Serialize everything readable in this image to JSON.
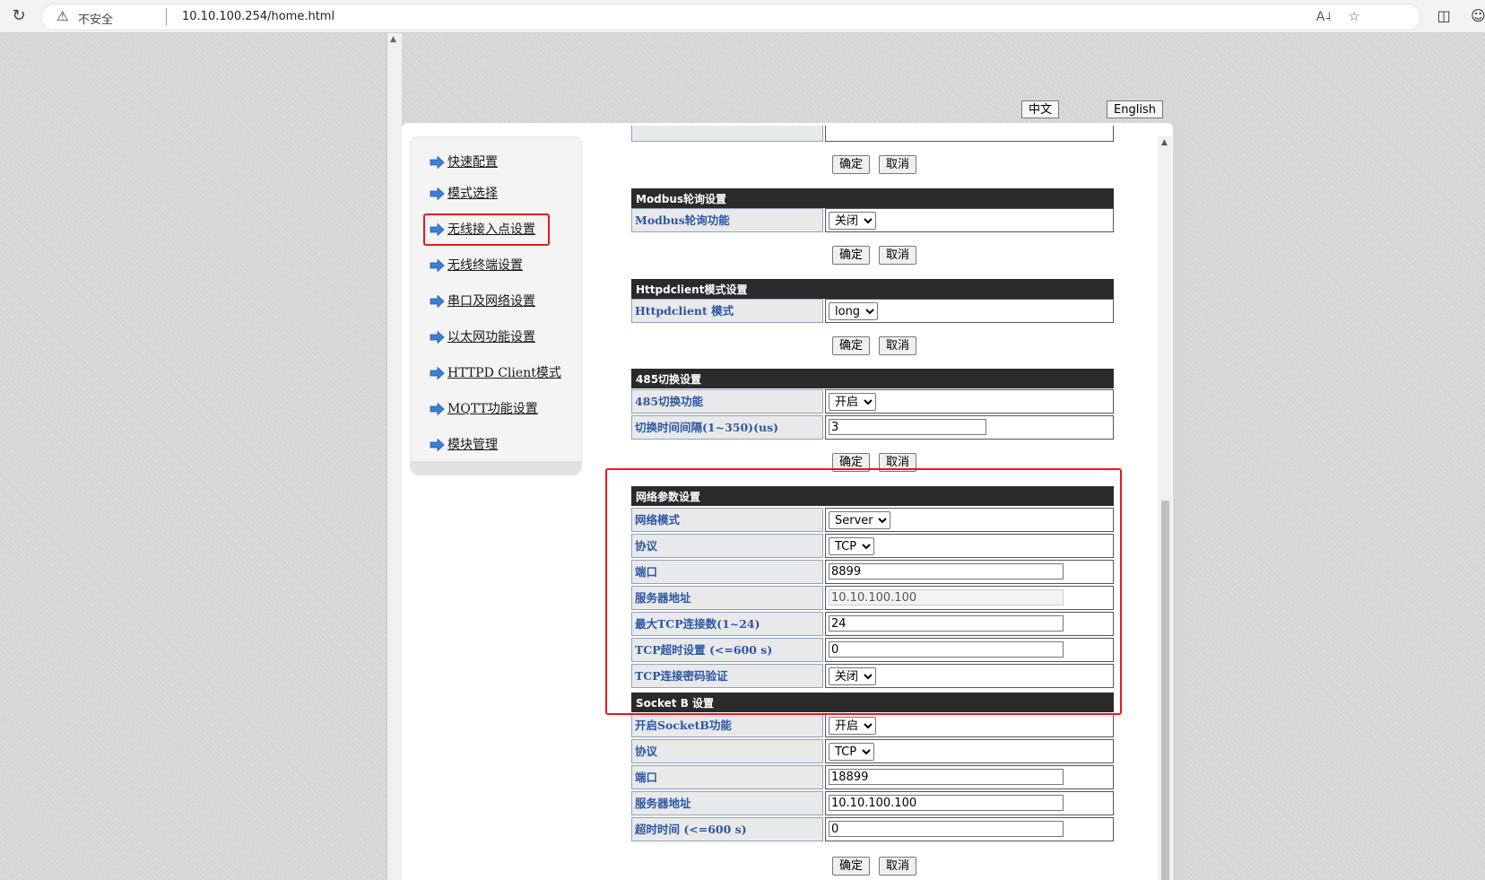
{
  "browser": {
    "security_label": "不安全",
    "url": "10.10.100.254/home.html",
    "icons": [
      "reload-icon",
      "warning-icon",
      "read-aloud-icon",
      "favorite-icon",
      "split-screen-icon",
      "profile-icon"
    ]
  },
  "language": {
    "zh": "中文",
    "en": "English"
  },
  "sidebar": {
    "items": [
      {
        "label": "快速配置"
      },
      {
        "label": "模式选择"
      },
      {
        "label": "无线接入点设置"
      },
      {
        "label": "无线终端设置"
      },
      {
        "label": "串口及网络设置"
      },
      {
        "label": "以太网功能设置"
      },
      {
        "label": "HTTPD Client模式"
      },
      {
        "label": "MQTT功能设置"
      },
      {
        "label": "模块管理"
      }
    ]
  },
  "buttons": {
    "ok": "确定",
    "cancel": "取消"
  },
  "modbus": {
    "title": "Modbus轮询设置",
    "rows": [
      {
        "label": "Modbus轮询功能",
        "value": "关闭"
      }
    ]
  },
  "httpd": {
    "title": "Httpdclient模式设置",
    "rows": [
      {
        "label": "Httpdclient 模式",
        "value": "long"
      }
    ]
  },
  "rs485": {
    "title": "485切换设置",
    "rows": [
      {
        "label": "485切换功能",
        "value": "开启"
      },
      {
        "label": "切换时间间隔(1~350)(us)",
        "value": "3"
      }
    ]
  },
  "network": {
    "title": "网络参数设置",
    "rows": [
      {
        "label": "网络模式",
        "value": "Server"
      },
      {
        "label": "协议",
        "value": "TCP"
      },
      {
        "label": "端口",
        "value": "8899"
      },
      {
        "label": "服务器地址",
        "value": "10.10.100.100"
      },
      {
        "label": "最大TCP连接数(1~24)",
        "value": "24"
      },
      {
        "label": "TCP超时设置 (<=600 s)",
        "value": "0"
      },
      {
        "label": "TCP连接密码验证",
        "value": "关闭"
      }
    ]
  },
  "socketb": {
    "title": "Socket B 设置",
    "rows": [
      {
        "label": "开启SocketB功能",
        "value": "开启"
      },
      {
        "label": "协议",
        "value": "TCP"
      },
      {
        "label": "端口",
        "value": "18899"
      },
      {
        "label": "服务器地址",
        "value": "10.10.100.100"
      },
      {
        "label": "超时时间 (<=600 s)",
        "value": "0"
      }
    ]
  },
  "colors": {
    "header_bg": "#2b2b2b",
    "label_text": "#2a57a6",
    "label_bg": "#e9e9e9",
    "highlight": "#e8181c",
    "nav_arrow": "#3b7fd9"
  }
}
